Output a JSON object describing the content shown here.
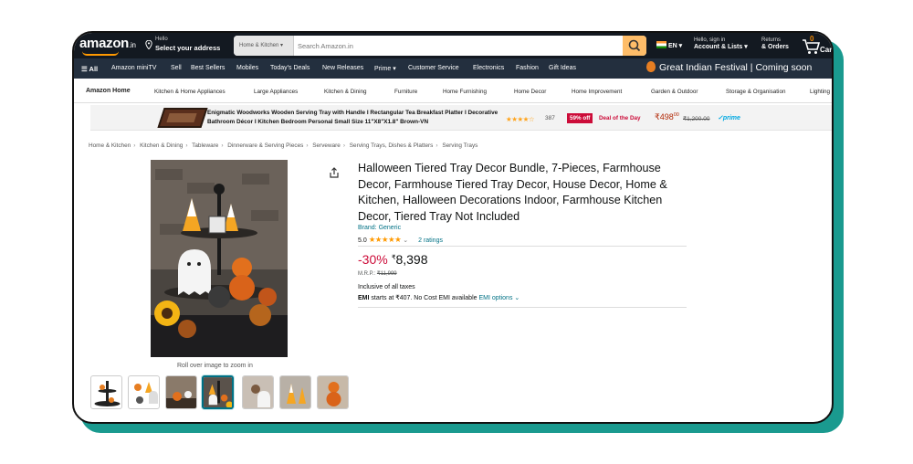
{
  "header": {
    "logo": "amazon",
    "logo_tld": ".in",
    "address_line1": "Hello",
    "address_line2": "Select your address",
    "search_category": "Home & Kitchen",
    "search_placeholder": "Search Amazon.in",
    "language": "EN",
    "account_line1": "Hello, sign in",
    "account_line2": "Account & Lists",
    "returns_line1": "Returns",
    "returns_line2": "& Orders",
    "cart_count": "0",
    "cart_label": "Cart"
  },
  "nav": {
    "all": "All",
    "items": [
      "Amazon miniTV",
      "Sell",
      "Best Sellers",
      "Mobiles",
      "Today's Deals",
      "New Releases",
      "Prime",
      "Customer Service",
      "Electronics",
      "Fashion",
      "Gift Ideas"
    ],
    "festival": "Great Indian Festival | Coming soon"
  },
  "category_bar": {
    "home": "Amazon Home",
    "items": [
      "Kitchen & Home Appliances",
      "Large Appliances",
      "Kitchen & Dining",
      "Furniture",
      "Home Furnishing",
      "Home Decor",
      "Home Improvement",
      "Garden & Outdoor",
      "Storage & Organisation",
      "Lighting"
    ]
  },
  "deal": {
    "title": "Enigmatic Woodworks Wooden Serving Tray with Handle I Rectangular Tea Breakfast Platter I Decorative Bathroom Décor I Kitchen Bedroom Personal Small Size 11\"X8\"X1.8\" Brown-VN",
    "stars": "★★★★☆",
    "rating_count": "387",
    "discount": "59% off",
    "deal_label": "Deal of the Day",
    "price": "₹498",
    "price_fraction": "00",
    "mrp": "₹1,200.00",
    "prime": "✓prime"
  },
  "breadcrumb": [
    "Home & Kitchen",
    "Kitchen & Dining",
    "Tableware",
    "Dinnerware & Serving Pieces",
    "Serveware",
    "Serving Trays, Dishes & Platters",
    "Serving Trays"
  ],
  "gallery": {
    "zoom_hint": "Roll over image to zoom in"
  },
  "product": {
    "title": "Halloween Tiered Tray Decor Bundle, 7-Pieces, Farmhouse Decor, Farmhouse Tiered Tray Decor, House Decor, Home & Kitchen, Halloween Decorations Indoor, Farmhouse Kitchen Decor, Tiered Tray Not Included",
    "brand": "Brand: Generic",
    "rating_value": "5.0",
    "stars": "★★★★★",
    "ratings_count": "2 ratings",
    "discount": "-30%",
    "currency": "₹",
    "price": "8,398",
    "mrp_label": "M.R.P.:",
    "mrp": "₹11,999",
    "taxes": "Inclusive of all taxes",
    "emi_label": "EMI",
    "emi_text": "starts at ₹407. No Cost EMI available",
    "emi_link": "EMI options"
  },
  "colors": {
    "nav_dark": "#131921",
    "nav_sub": "#232f3e",
    "accent": "#ff9900",
    "discount_red": "#cc0c39",
    "link": "#007185",
    "frame_shadow": "#1a9a8f"
  }
}
